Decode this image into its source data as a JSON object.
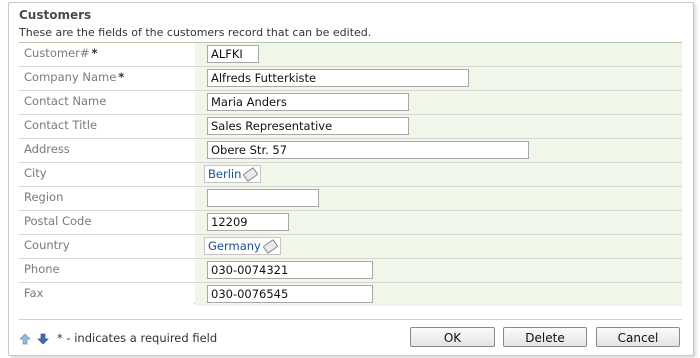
{
  "header": {
    "title": "Customers",
    "description": "These are the fields of the customers record that can be edited."
  },
  "fields": [
    {
      "label": "Customer#",
      "required": "*",
      "value": "ALFKI",
      "kind": "input"
    },
    {
      "label": "Company Name",
      "required": "*",
      "value": "Alfreds Futterkiste",
      "kind": "input"
    },
    {
      "label": "Contact Name",
      "required": "",
      "value": "Maria Anders",
      "kind": "input"
    },
    {
      "label": "Contact Title",
      "required": "",
      "value": "Sales Representative",
      "kind": "input"
    },
    {
      "label": "Address",
      "required": "",
      "value": "Obere Str. 57",
      "kind": "input"
    },
    {
      "label": "City",
      "required": "",
      "value": "Berlin",
      "kind": "lookup"
    },
    {
      "label": "Region",
      "required": "",
      "value": "",
      "kind": "input"
    },
    {
      "label": "Postal Code",
      "required": "",
      "value": "12209",
      "kind": "input"
    },
    {
      "label": "Country",
      "required": "",
      "value": "Germany",
      "kind": "lookup"
    },
    {
      "label": "Phone",
      "required": "",
      "value": "030-0074321",
      "kind": "input"
    },
    {
      "label": "Fax",
      "required": "",
      "value": "030-0076545",
      "kind": "input"
    }
  ],
  "footer": {
    "hint": "* - indicates a required field",
    "ok_label": "OK",
    "delete_label": "Delete",
    "cancel_label": "Cancel"
  },
  "colors": {
    "value_bg": "#f0f6e8",
    "label_text": "#7a7a7a",
    "lookup_text": "#1a4f99",
    "arrow_up": "#9bb7d6",
    "arrow_down": "#3f6fb0"
  }
}
